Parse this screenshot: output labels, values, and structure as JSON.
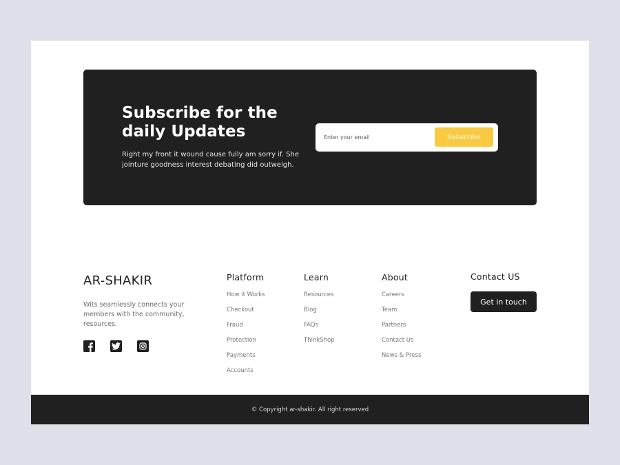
{
  "newsletter": {
    "title": "Subscribe for the daily Updates",
    "description": "Right my front it wound cause fully am sorry if. She jointure goodness interest debating did outweigh.",
    "email_placeholder": "Enter your email",
    "email_value": "",
    "subscribe_label": "Subscribe"
  },
  "brand": {
    "name": "AR-SHAKIR",
    "description": "Wits seamlessly connects your members with the community, resources.",
    "socials": [
      {
        "icon": "facebook-icon"
      },
      {
        "icon": "twitter-icon"
      },
      {
        "icon": "instagram-icon"
      }
    ]
  },
  "columns": {
    "platform": {
      "title": "Platform",
      "links": [
        "How it Works",
        "Checkout",
        "Fraud",
        "Protection",
        "Payments",
        "Accounts"
      ]
    },
    "learn": {
      "title": "Learn",
      "links": [
        "Resources",
        "Blog",
        "FAQs",
        "ThinkShop"
      ]
    },
    "about": {
      "title": "About",
      "links": [
        "Careers",
        "Team",
        "Partners",
        "Contact Us",
        "News & Press"
      ]
    },
    "contact": {
      "title": "Contact US",
      "button_label": "Get in touch"
    }
  },
  "footer": {
    "copyright": "© Copyright ar-shakir. All right reserved"
  },
  "colors": {
    "dark": "#202020",
    "accent": "#f9c940",
    "background": "#dfe1ea"
  }
}
